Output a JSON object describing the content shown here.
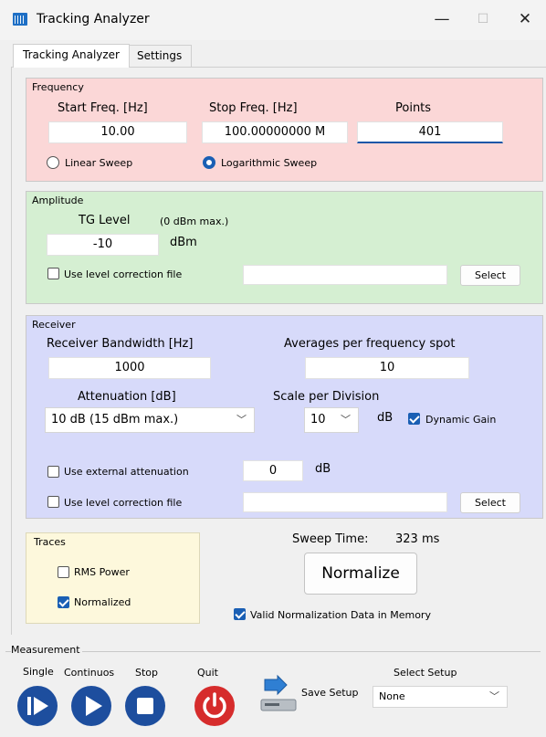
{
  "window": {
    "title": "Tracking Analyzer",
    "minimize": "—",
    "maximize": "☐",
    "close": "✕"
  },
  "tabs": [
    "Tracking Analyzer",
    "Settings"
  ],
  "frequency": {
    "title": "Frequency",
    "start_label": "Start Freq. [Hz]",
    "stop_label": "Stop Freq. [Hz]",
    "points_label": "Points",
    "start_value": "10.00",
    "stop_value": "100.00000000 M",
    "points_value": "401",
    "linear_label": "Linear Sweep",
    "log_label": "Logarithmic Sweep",
    "selected_sweep": "Logarithmic Sweep"
  },
  "amplitude": {
    "title": "Amplitude",
    "tg_label": "TG Level",
    "tg_max": "(0 dBm max.)",
    "tg_value": "-10",
    "tg_unit": "dBm",
    "use_correction_label": "Use level correction file",
    "use_correction_checked": false,
    "correction_file": "",
    "select_label": "Select"
  },
  "receiver": {
    "title": "Receiver",
    "rbw_label": "Receiver Bandwidth [Hz]",
    "rbw_value": "1000",
    "avg_label": "Averages per frequency spot",
    "avg_value": "10",
    "att_label": "Attenuation [dB]",
    "att_value": "10 dB (15 dBm max.)",
    "scale_label": "Scale per Division",
    "scale_value": "10",
    "scale_unit": "dB",
    "dynamic_gain_label": "Dynamic Gain",
    "dynamic_gain_checked": true,
    "ext_att_label": "Use external attenuation",
    "ext_att_checked": false,
    "ext_att_value": "0",
    "ext_att_unit": "dB",
    "use_correction_label": "Use level correction file",
    "use_correction_checked": false,
    "correction_file": "",
    "select_label": "Select"
  },
  "traces": {
    "title": "Traces",
    "rms_label": "RMS Power",
    "rms_checked": false,
    "normalized_label": "Normalized",
    "normalized_checked": true
  },
  "sweep": {
    "time_label": "Sweep Time:",
    "time_value": "323 ms",
    "normalize_label": "Normalize",
    "valid_norm_label": "Valid Normalization Data in Memory",
    "valid_norm_checked": true
  },
  "measurement": {
    "title": "Measurement",
    "single_label": "Single",
    "continuous_label": "Continuos",
    "stop_label": "Stop",
    "quit_label": "Quit",
    "save_setup_label": "Save Setup",
    "select_setup_label": "Select Setup",
    "setup_value": "None"
  },
  "colors": {
    "frequency_bg": "#fbd7d7",
    "amplitude_bg": "#d5efd2",
    "receiver_bg": "#d7dafa",
    "traces_bg": "#fdf8dc",
    "accent": "#1a5fb4",
    "quit_red": "#d62c2c",
    "control_blue": "#1d4e9e"
  }
}
